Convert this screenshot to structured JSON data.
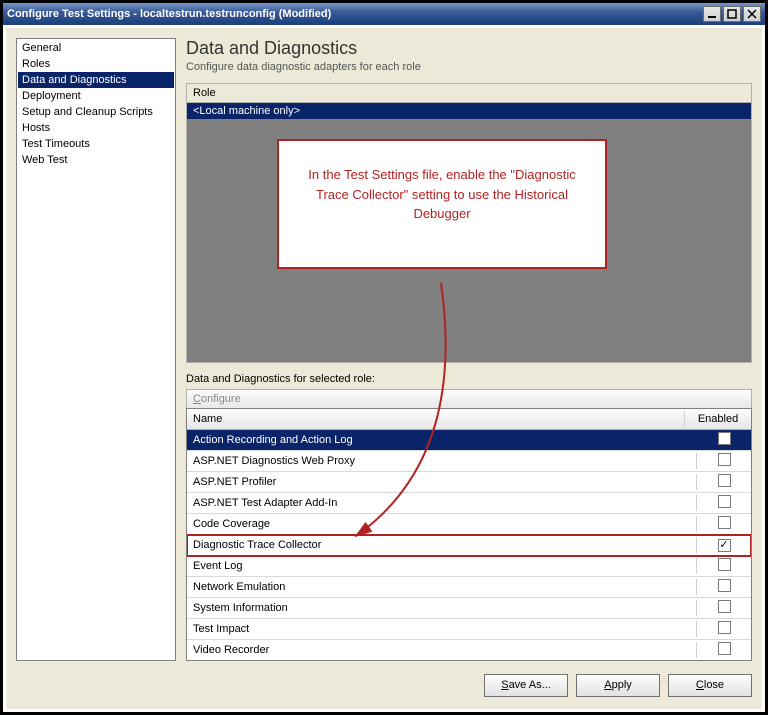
{
  "window": {
    "title": "Configure Test Settings - localtestrun.testrunconfig (Modified)"
  },
  "sidebar": {
    "items": [
      "General",
      "Roles",
      "Data and Diagnostics",
      "Deployment",
      "Setup and Cleanup Scripts",
      "Hosts",
      "Test Timeouts",
      "Web Test"
    ],
    "selected_index": 2
  },
  "main": {
    "title": "Data and Diagnostics",
    "subtitle": "Configure data diagnostic adapters for each role",
    "role_header": "Role",
    "role_value": "<Local machine only>",
    "grid_label": "Data and Diagnostics for selected role:",
    "configure_label_u": "C",
    "configure_label_rest": "onfigure",
    "columns": {
      "name": "Name",
      "enabled": "Enabled"
    },
    "rows": [
      {
        "name": "Action Recording and Action Log",
        "enabled": false,
        "selected": true
      },
      {
        "name": "ASP.NET Diagnostics Web Proxy",
        "enabled": false
      },
      {
        "name": "ASP.NET Profiler",
        "enabled": false
      },
      {
        "name": "ASP.NET Test Adapter Add-In",
        "enabled": false
      },
      {
        "name": "Code Coverage",
        "enabled": false
      },
      {
        "name": "Diagnostic Trace Collector",
        "enabled": true,
        "highlighted": true
      },
      {
        "name": "Event Log",
        "enabled": false
      },
      {
        "name": "Network Emulation",
        "enabled": false
      },
      {
        "name": "System Information",
        "enabled": false
      },
      {
        "name": "Test Impact",
        "enabled": false
      },
      {
        "name": "Video Recorder",
        "enabled": false
      }
    ]
  },
  "annotation": {
    "text": "In the Test Settings file, enable the \"Diagnostic Trace Collector\" setting to use the Historical Debugger",
    "color": "#b22222"
  },
  "buttons": {
    "save_as_u": "S",
    "save_as_rest": "ave As...",
    "apply_u": "A",
    "apply_rest": "pply",
    "close_u": "C",
    "close_rest": "lose"
  }
}
